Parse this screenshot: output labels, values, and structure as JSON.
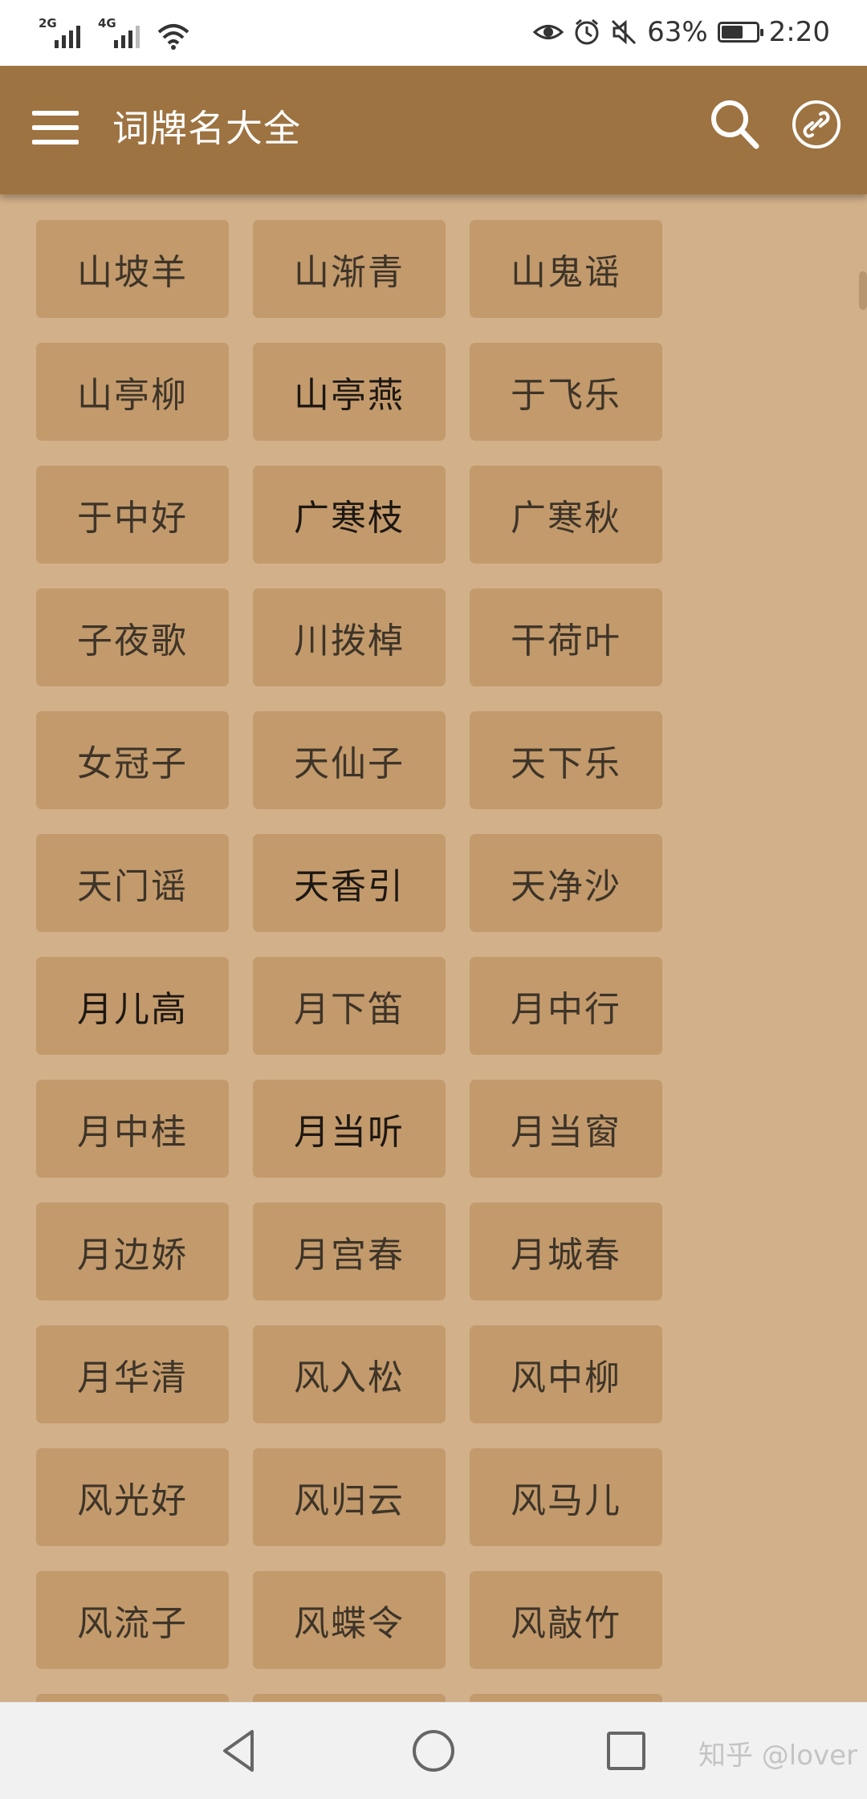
{
  "status_bar": {
    "sim1_network": "2G",
    "sim2_network": "4G",
    "battery_percent": "63%",
    "time": "2:20",
    "battery_level": 0.63
  },
  "app_bar": {
    "title": "词牌名大全",
    "background_color": "#9d7341"
  },
  "content": {
    "background_color": "#d2b08a",
    "chip_color": "#c29a6c",
    "items": [
      "山坡羊",
      "山渐青",
      "山鬼谣",
      "山亭柳",
      "山亭燕",
      "于飞乐",
      "于中好",
      "广寒枝",
      "广寒秋",
      "子夜歌",
      "川拨棹",
      "干荷叶",
      "女冠子",
      "天仙子",
      "天下乐",
      "天门谣",
      "天香引",
      "天净沙",
      "月儿高",
      "月下笛",
      "月中行",
      "月中桂",
      "月当听",
      "月当窗",
      "月边娇",
      "月宫春",
      "月城春",
      "月华清",
      "风入松",
      "风中柳",
      "风光好",
      "风归云",
      "风马儿",
      "风流子",
      "风蝶令",
      "风敲竹"
    ]
  },
  "watermark": "知乎 @lover"
}
